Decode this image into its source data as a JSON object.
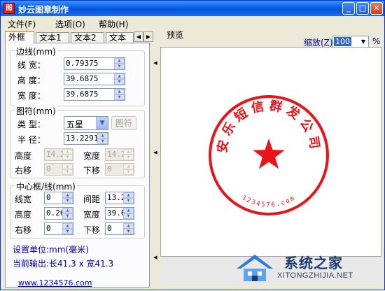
{
  "window": {
    "title": "妙云图章制作",
    "icon_text": "图",
    "controls": {
      "minimize": "_",
      "maximize": "□",
      "close": "✕"
    }
  },
  "menu": [
    "文件(F)",
    "选项(O)",
    "帮助(H)"
  ],
  "tabs": [
    "外框",
    "文本1",
    "文本2",
    "文本"
  ],
  "tab_scroll": {
    "left": "◀",
    "right": "▶"
  },
  "border_group": {
    "title": "边线(mm)",
    "line_width_label": "线  宽：",
    "line_width": "0.79375",
    "height_label": "高  度：",
    "height": "39.6875",
    "width_label": "宽  度：",
    "width": "39.6875"
  },
  "symbol_group": {
    "title": "图符(mm)",
    "type_label": "类  型：",
    "type_value": "五星",
    "symbol_button": "图符",
    "radius_label": "半  径：",
    "radius": "13.2291",
    "height_label": "高度",
    "height": "14.2",
    "width_label": "宽度",
    "width": "14.2",
    "right_label": "右移",
    "right": "0",
    "down_label": "下移",
    "down": "0"
  },
  "center_group": {
    "title": "中心框/线(mm)",
    "line_width_label": "线宽",
    "line_width": "0",
    "spacing_label": "间距",
    "spacing": "13.2",
    "height_label": "高度",
    "height": "0.26",
    "width_label": "宽度",
    "width": "39.6",
    "right_label": "右移",
    "right": "0",
    "down_label": "下移",
    "down": "0"
  },
  "status": {
    "unit": "设置单位:mm(毫米)",
    "output": "当前输出:长41.3 x 宽41.3",
    "link": "www.1234576.com"
  },
  "preview": {
    "label": "预览",
    "zoom_label": "缩放(Z)",
    "zoom_value": "100",
    "zoom_unit": "%"
  },
  "stamp": {
    "text": "安乐短信群发公司",
    "bottom_text": "1234576.com",
    "color": "#e8141a"
  },
  "watermark": {
    "cn": "系统之家",
    "en": "XITONGZHIJIA.NET"
  }
}
